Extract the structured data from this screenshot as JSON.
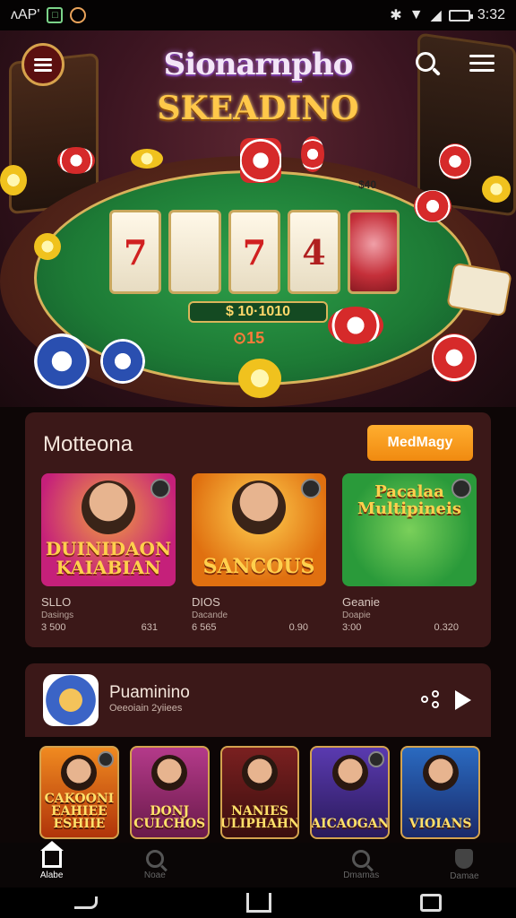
{
  "status_bar": {
    "left_text": "ʌΑΡ'",
    "time": "3:32"
  },
  "hero": {
    "logo_top": "Sionarnpho",
    "logo_bottom": "SKEADINO",
    "jackpot": "$ 10·1010",
    "bet": "⊙15",
    "felt_label": "$40",
    "reels": [
      "7",
      "",
      "7",
      "4",
      ""
    ]
  },
  "section_featured": {
    "title": "Motteona",
    "more_label": "MedMagy",
    "games": [
      {
        "title": "DUINIDAON KAIABIAN",
        "name": "SLLO",
        "sub": "Dasings",
        "left": "3 500",
        "right": "631",
        "thumb": "#c5207a",
        "thumb2": "#f2a040"
      },
      {
        "title": "SANCOUS",
        "name": "DIOS",
        "sub": "Dacande",
        "left": "6 565",
        "right": "0.90",
        "thumb": "#f0a020",
        "thumb2": "#e06010"
      },
      {
        "title": "Pacalaa Multipineis",
        "name": "Geanie",
        "sub": "Doapie",
        "left": "3:00",
        "right": "0.320",
        "thumb": "#2a9a3a",
        "thumb2": "#7ad05a"
      }
    ]
  },
  "section_playlist": {
    "title": "Puaminino",
    "subtitle": "Oeeoiain 2yiiees",
    "games": [
      {
        "label": "CAKOONI EAHIEE ESHIIE",
        "bg1": "#f08a20",
        "bg2": "#b0340a"
      },
      {
        "label": "DONJ CULCHOS",
        "bg1": "#b43a8a",
        "bg2": "#6a1a4a"
      },
      {
        "label": "NANIES PULIPHAHNS",
        "bg1": "#7a2020",
        "bg2": "#3a0e0e"
      },
      {
        "label": "AICAOGAN",
        "bg1": "#5a3ab0",
        "bg2": "#2a1a5a"
      },
      {
        "label": "VIOIANS",
        "bg1": "#2a6ac0",
        "bg2": "#1a2a6a"
      }
    ]
  },
  "bottom_nav": [
    {
      "label": "Alabe",
      "icon": "home-icon",
      "active": true
    },
    {
      "label": "Noae",
      "icon": "search-icon",
      "active": false
    },
    {
      "label": "",
      "icon": "",
      "active": false
    },
    {
      "label": "Dmamas",
      "icon": "search-icon",
      "active": false
    },
    {
      "label": "Damae",
      "icon": "shield-icon",
      "active": false
    }
  ]
}
